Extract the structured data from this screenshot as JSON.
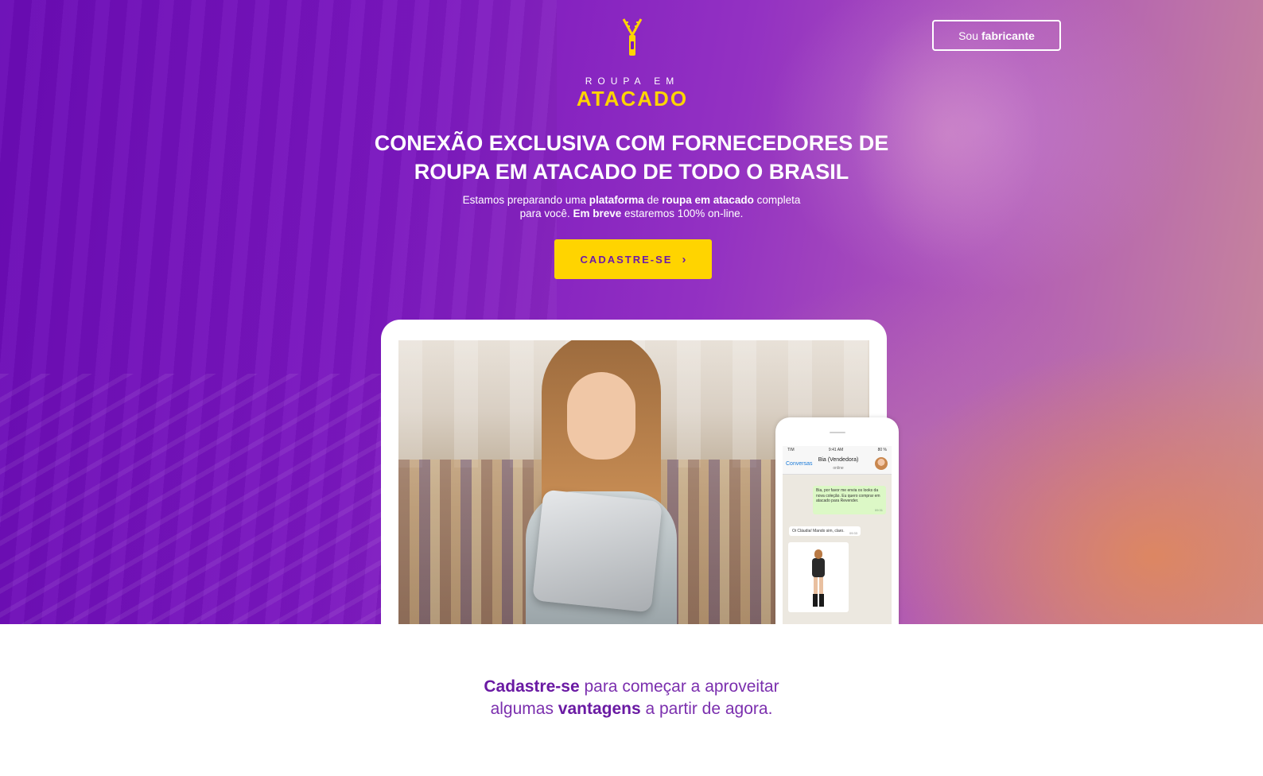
{
  "header": {
    "maker_button": {
      "prefix": "Sou",
      "bold": "fabricante"
    },
    "logo": {
      "top": "ROUPA EM",
      "main": "ATACADO"
    }
  },
  "hero": {
    "headline": {
      "line1": [
        {
          "text": "CONEXÃO",
          "bold": true
        },
        {
          "text": " EXCLUSIVA COM ",
          "bold": false
        },
        {
          "text": "FORNECEDORES",
          "bold": true
        },
        {
          "text": " DE",
          "bold": false
        }
      ],
      "line2": [
        {
          "text": "ROUPA EM ATACADO",
          "bold": true
        },
        {
          "text": " DE TODO O ",
          "bold": false
        },
        {
          "text": "BRASIL",
          "bold": true
        }
      ]
    },
    "subtitle": {
      "line1": [
        {
          "text": "Estamos preparando uma ",
          "bold": false
        },
        {
          "text": "plataforma",
          "bold": true
        },
        {
          "text": " de ",
          "bold": false
        },
        {
          "text": "roupa em atacado",
          "bold": true
        },
        {
          "text": " completa",
          "bold": false
        }
      ],
      "line2": [
        {
          "text": "para você. ",
          "bold": false
        },
        {
          "text": "Em breve",
          "bold": true
        },
        {
          "text": " estaremos 100% on-line.",
          "bold": false
        }
      ]
    },
    "cta": {
      "label": "CADASTRE-SE",
      "arrow": "›"
    }
  },
  "phone": {
    "status_left": "TIM",
    "status_time": "9:41 AM",
    "status_right": "80 %",
    "back_label": "Conversas",
    "contact_name": "Bia (Vendedora)",
    "contact_status": "online",
    "message_out": "Bia, por favor me envia os looks da nova coleção. Eu quero comprar em atacado para Revender.",
    "message_out_time": "09:31",
    "message_in": "Oi Cláudia! Mando sim, claro.",
    "message_in_time": "09:33"
  },
  "bottom": {
    "line1": [
      {
        "text": "Cadastre-se",
        "bold": true
      },
      {
        "text": " para começar a aproveitar",
        "bold": false
      }
    ],
    "line2": [
      {
        "text": "algumas ",
        "bold": false
      },
      {
        "text": "vantagens",
        "bold": true
      },
      {
        "text": " a partir de agora.",
        "bold": false
      }
    ]
  },
  "colors": {
    "brand_purple": "#6a0bb5",
    "accent_yellow": "#ffd400",
    "text_purple": "#7b2fae"
  },
  "icons": {
    "logo_icon": "zipper-icon",
    "cta_icon": "chevron-right-icon"
  }
}
